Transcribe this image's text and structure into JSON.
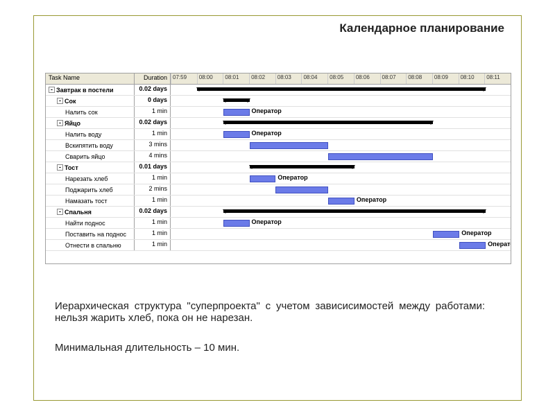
{
  "title": "Календарное планирование",
  "columns": {
    "name": "Task Name",
    "duration": "Duration"
  },
  "time_axis": [
    "07:59",
    "08:00",
    "08:01",
    "08:02",
    "08:03",
    "08:04",
    "08:05",
    "08:06",
    "08:07",
    "08:08",
    "08:09",
    "08:10",
    "08:11"
  ],
  "operator_label": "Оператор",
  "tasks": [
    {
      "id": 0,
      "name": "Завтрак в постели",
      "dur": "0.02 days",
      "lvl": 0,
      "summary": true,
      "start": 0,
      "end": 11
    },
    {
      "id": 1,
      "name": "Сок",
      "dur": "0 days",
      "lvl": 1,
      "summary": true,
      "start": 1,
      "end": 2
    },
    {
      "id": 2,
      "name": "Налить сок",
      "dur": "1 min",
      "lvl": 2,
      "start": 1,
      "end": 2,
      "label": true
    },
    {
      "id": 3,
      "name": "Яйцо",
      "dur": "0.02 days",
      "lvl": 1,
      "summary": true,
      "start": 1,
      "end": 9
    },
    {
      "id": 4,
      "name": "Налить воду",
      "dur": "1 min",
      "lvl": 2,
      "start": 1,
      "end": 2,
      "label": true
    },
    {
      "id": 5,
      "name": "Вскипятить воду",
      "dur": "3 mins",
      "lvl": 2,
      "start": 2,
      "end": 5
    },
    {
      "id": 6,
      "name": "Сварить яйцо",
      "dur": "4 mins",
      "lvl": 2,
      "start": 5,
      "end": 9
    },
    {
      "id": 7,
      "name": "Тост",
      "dur": "0.01 days",
      "lvl": 1,
      "summary": true,
      "start": 2,
      "end": 6
    },
    {
      "id": 8,
      "name": "Нарезать хлеб",
      "dur": "1 min",
      "lvl": 2,
      "start": 2,
      "end": 3,
      "label": true
    },
    {
      "id": 9,
      "name": "Поджарить хлеб",
      "dur": "2 mins",
      "lvl": 2,
      "start": 3,
      "end": 5
    },
    {
      "id": 10,
      "name": "Намазать тост",
      "dur": "1 min",
      "lvl": 2,
      "start": 5,
      "end": 6,
      "label": true
    },
    {
      "id": 11,
      "name": "Спальня",
      "dur": "0.02 days",
      "lvl": 1,
      "summary": true,
      "start": 1,
      "end": 11
    },
    {
      "id": 12,
      "name": "Найти поднос",
      "dur": "1 min",
      "lvl": 2,
      "start": 1,
      "end": 2,
      "label": true
    },
    {
      "id": 13,
      "name": "Поставить на поднос",
      "dur": "1 min",
      "lvl": 2,
      "start": 9,
      "end": 10,
      "label": true
    },
    {
      "id": 14,
      "name": "Отнести в спальню",
      "dur": "1 min",
      "lvl": 2,
      "start": 10,
      "end": 11,
      "label": true
    }
  ],
  "caption1": "Иерархическая структура \"суперпроекта\" с учетом зависисимостей между работами: нельзя жарить хлеб, пока он не нарезан.",
  "caption2": "Минимальная длительность – 10 мин.",
  "chart_data": {
    "type": "gantt",
    "title": "Календарное планирование — Завтрак в постели",
    "time_unit": "minutes from 08:00",
    "x_range": [
      -1,
      12
    ],
    "x_ticks": [
      "07:59",
      "08:00",
      "08:01",
      "08:02",
      "08:03",
      "08:04",
      "08:05",
      "08:06",
      "08:07",
      "08:08",
      "08:09",
      "08:10",
      "08:11"
    ],
    "resource": "Оператор",
    "series": [
      {
        "name": "Завтрак в постели",
        "type": "summary",
        "start": 0,
        "end": 11,
        "level": 0
      },
      {
        "name": "Сок",
        "type": "summary",
        "start": 1,
        "end": 2,
        "level": 1
      },
      {
        "name": "Налить сок",
        "type": "task",
        "start": 1,
        "end": 2,
        "duration_min": 1,
        "level": 2,
        "resource": "Оператор"
      },
      {
        "name": "Яйцо",
        "type": "summary",
        "start": 1,
        "end": 9,
        "level": 1
      },
      {
        "name": "Налить воду",
        "type": "task",
        "start": 1,
        "end": 2,
        "duration_min": 1,
        "level": 2,
        "resource": "Оператор"
      },
      {
        "name": "Вскипятить воду",
        "type": "task",
        "start": 2,
        "end": 5,
        "duration_min": 3,
        "level": 2
      },
      {
        "name": "Сварить яйцо",
        "type": "task",
        "start": 5,
        "end": 9,
        "duration_min": 4,
        "level": 2
      },
      {
        "name": "Тост",
        "type": "summary",
        "start": 2,
        "end": 6,
        "level": 1
      },
      {
        "name": "Нарезать хлеб",
        "type": "task",
        "start": 2,
        "end": 3,
        "duration_min": 1,
        "level": 2,
        "resource": "Оператор"
      },
      {
        "name": "Поджарить хлеб",
        "type": "task",
        "start": 3,
        "end": 5,
        "duration_min": 2,
        "level": 2
      },
      {
        "name": "Намазать тост",
        "type": "task",
        "start": 5,
        "end": 6,
        "duration_min": 1,
        "level": 2,
        "resource": "Оператор"
      },
      {
        "name": "Спальня",
        "type": "summary",
        "start": 1,
        "end": 11,
        "level": 1
      },
      {
        "name": "Найти поднос",
        "type": "task",
        "start": 1,
        "end": 2,
        "duration_min": 1,
        "level": 2,
        "resource": "Оператор"
      },
      {
        "name": "Поставить на поднос",
        "type": "task",
        "start": 9,
        "end": 10,
        "duration_min": 1,
        "level": 2,
        "resource": "Оператор"
      },
      {
        "name": "Отнести в спальню",
        "type": "task",
        "start": 10,
        "end": 11,
        "duration_min": 1,
        "level": 2,
        "resource": "Оператор"
      }
    ],
    "dependencies": [
      {
        "from": "Налить воду",
        "to": "Вскипятить воду"
      },
      {
        "from": "Вскипятить воду",
        "to": "Сварить яйцо"
      },
      {
        "from": "Нарезать хлеб",
        "to": "Поджарить хлеб"
      },
      {
        "from": "Поджарить хлеб",
        "to": "Намазать тост"
      },
      {
        "from": "Сварить яйцо",
        "to": "Поставить на поднос"
      },
      {
        "from": "Поставить на поднос",
        "to": "Отнести в спальню"
      }
    ]
  }
}
